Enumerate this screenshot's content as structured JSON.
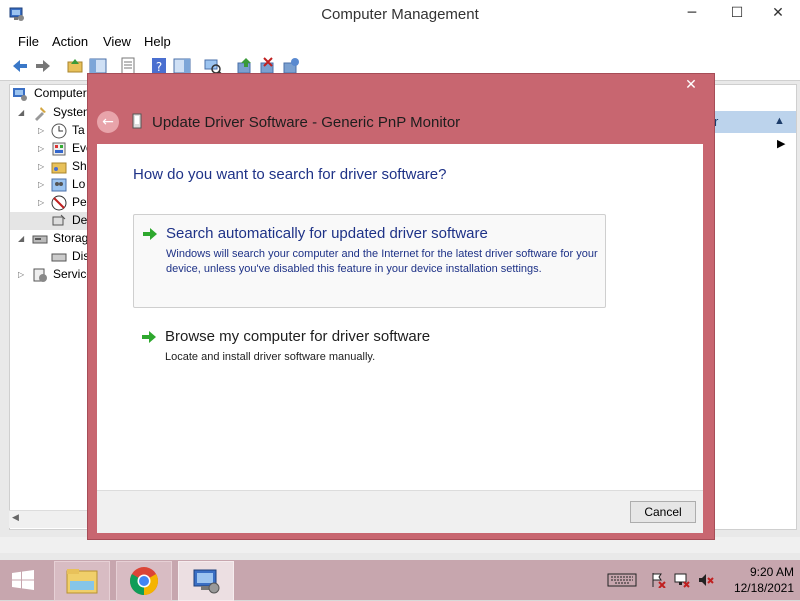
{
  "window": {
    "title": "Computer Management",
    "minimize": "─",
    "maximize": "☐",
    "close": "✕"
  },
  "menu": [
    "File",
    "Action",
    "View",
    "Help"
  ],
  "tree": [
    {
      "label": "Computer",
      "expander": "",
      "level": 0
    },
    {
      "label": "System",
      "expander": "◢",
      "level": 1
    },
    {
      "label": "Ta",
      "expander": "▷",
      "level": 2
    },
    {
      "label": "Eve",
      "expander": "▷",
      "level": 2
    },
    {
      "label": "Sh",
      "expander": "▷",
      "level": 2
    },
    {
      "label": "Lo",
      "expander": "▷",
      "level": 2
    },
    {
      "label": "Pe",
      "expander": "▷",
      "level": 2
    },
    {
      "label": "De",
      "expander": "",
      "level": 2
    },
    {
      "label": "Storag",
      "expander": "◢",
      "level": 1
    },
    {
      "label": "Dis",
      "expander": "",
      "level": 2
    },
    {
      "label": "Service",
      "expander": "▷",
      "level": 1
    }
  ],
  "actions": {
    "header_fragment": "r",
    "collapse_glyph": "▲",
    "submenu_glyph": "▶"
  },
  "dialog": {
    "title": "Update Driver Software - Generic PnP Monitor",
    "close": "✕",
    "back": "←",
    "question": "How do you want to search for driver software?",
    "options": [
      {
        "title": "Search automatically for updated driver software",
        "description": "Windows will search your computer and the Internet for the latest driver software for your device, unless you've disabled this feature in your device installation settings."
      },
      {
        "title": "Browse my computer for driver software",
        "description": "Locate and install driver software manually."
      }
    ],
    "cancel_label": "Cancel"
  },
  "taskbar": {
    "apps": [
      "file-explorer",
      "chrome",
      "computer-management"
    ],
    "time": "9:20 AM",
    "date": "12/18/2021"
  },
  "colors": {
    "dialog_frame": "#c86670",
    "taskbar": "#c7a6ae",
    "link_blue": "#1e3287",
    "arrow_green": "#2ea82e"
  }
}
